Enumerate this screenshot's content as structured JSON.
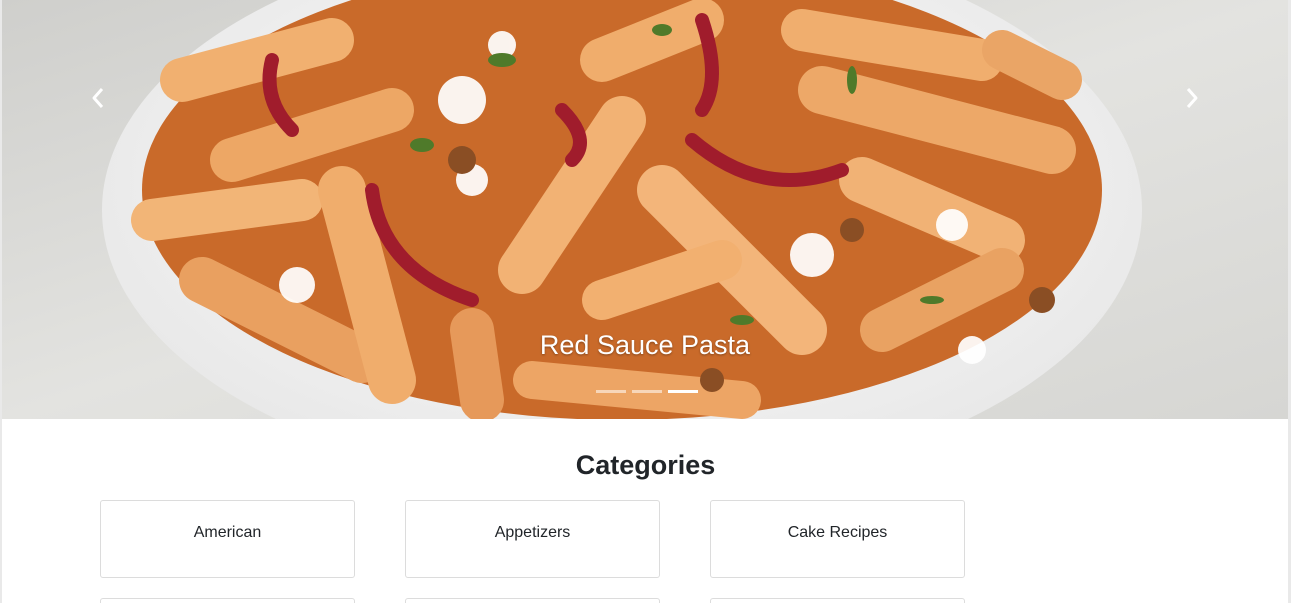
{
  "carousel": {
    "caption": "Red Sauce Pasta",
    "prev_icon": "chevron-left-icon",
    "next_icon": "chevron-right-icon",
    "slide_count": 3,
    "active_index": 2,
    "image_subject": "pasta-bowl-photo"
  },
  "categories": {
    "title": "Categories",
    "items": [
      {
        "label": "American"
      },
      {
        "label": "Appetizers"
      },
      {
        "label": "Cake Recipes"
      }
    ]
  },
  "colors": {
    "text": "#212529",
    "card_border": "#dcdcdc",
    "indicator_active": "#ffffff"
  }
}
